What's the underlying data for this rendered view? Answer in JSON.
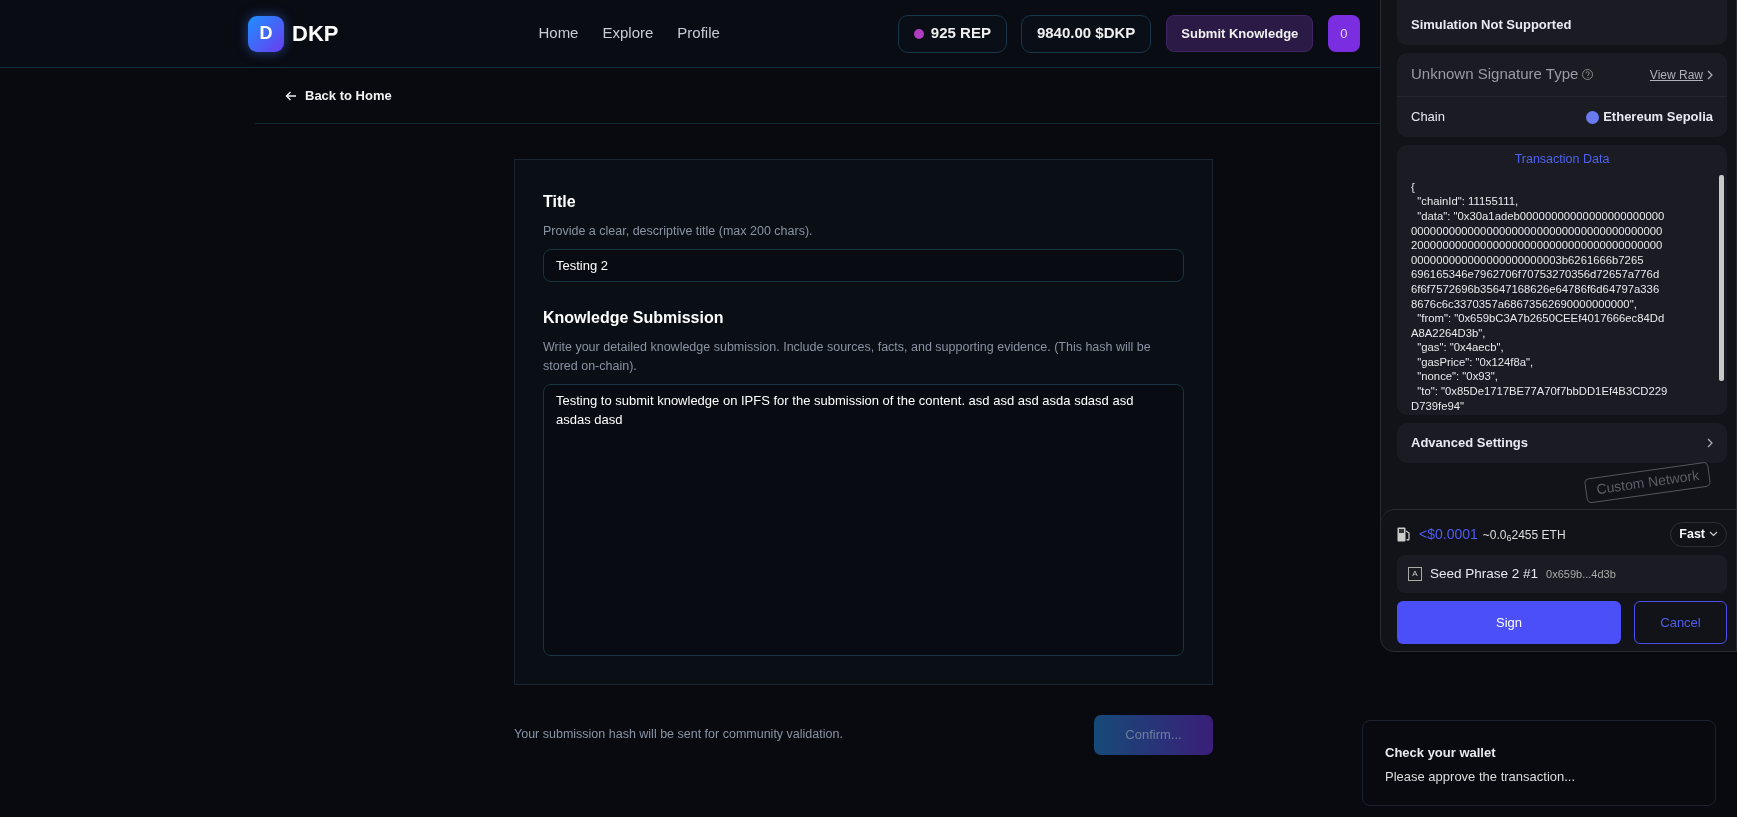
{
  "header": {
    "logo_letter": "D",
    "brand": "DKP",
    "nav": [
      {
        "label": "Home"
      },
      {
        "label": "Explore"
      },
      {
        "label": "Profile"
      }
    ],
    "rep": {
      "text": "925 REP",
      "color": "#b03cc0"
    },
    "balance": "9840.00 $DKP",
    "submit_button": "Submit Knowledge",
    "wallet_button": "0"
  },
  "back_link": "Back to Home",
  "form": {
    "title_label": "Title",
    "title_help": "Provide a clear, descriptive title (max 200 chars).",
    "title_value": "Testing 2",
    "body_label": "Knowledge Submission",
    "body_help": "Write your detailed knowledge submission. Include sources, facts, and supporting evidence. (This hash will be stored on-chain).",
    "body_value": "Testing to submit knowledge on IPFS for the submission of the content. asd asd asd asda sdasd asd asdas dasd"
  },
  "footer_note": "Your submission hash will be sent for community validation.",
  "confirm_button": {
    "label": "Confirm...",
    "disabled": true
  },
  "wallet": {
    "simulation": "Simulation Not Supported",
    "signature_type": "Unknown Signature Type",
    "view_raw": "View Raw",
    "chain_label": "Chain",
    "chain_value": "Ethereum Sepolia",
    "tx_title": "Transaction Data",
    "tx_lines": [
      "{",
      "  \"chainId\": 11155111,",
      "  \"data\": \"0x30a1adeb00000000000000000000000",
      "0000000000000000000000000000000000000000",
      "2000000000000000000000000000000000000000",
      "000000000000000000000003b6261666b7265",
      "696165346e7962706f70753270356d72657a776d",
      "6f6f7572696b35647168626e64786f6d64797a336",
      "8676c6c3370357a68673562690000000000\",",
      "  \"from\": \"0x659bC3A7b2650CEEf4017666ec84Dd",
      "A8A2264D3b\",",
      "  \"gas\": \"0x4aecb\",",
      "  \"gasPrice\": \"0x124f8a\",",
      "  \"nonce\": \"0x93\",",
      "  \"to\": \"0x85De1717BE77A70f7bbDD1Ef4B3CD229",
      "D739fe94\""
    ],
    "advanced": "Advanced Settings",
    "stamp": "Custom Network",
    "fee_usd": "<$0.0001",
    "fee_eth": "~0.0",
    "fee_eth_sub": "6",
    "fee_eth_rest": "2455 ETH",
    "speed": "Fast",
    "account_letter": "A",
    "account_name": "Seed Phrase 2 #1",
    "account_address": "0x659b...4d3b",
    "sign": "Sign",
    "cancel": "Cancel"
  },
  "toast": {
    "title": "Check your wallet",
    "message": "Please approve the transaction..."
  }
}
